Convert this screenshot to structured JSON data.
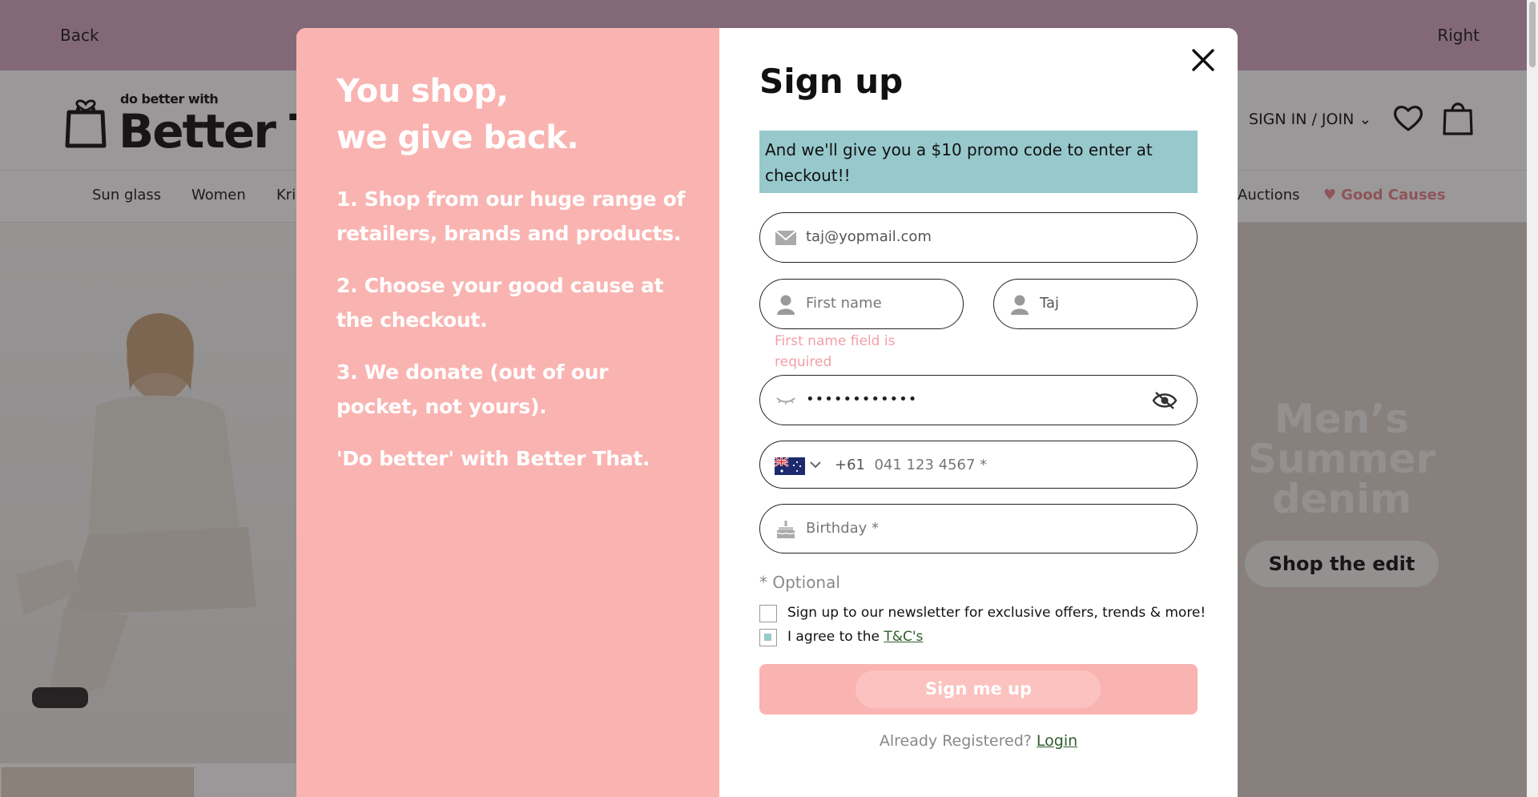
{
  "topbar": {
    "back_label": "Back",
    "right_label": "Right"
  },
  "header": {
    "logo_tagline": "do better with",
    "logo_text": "Better That",
    "signin_label": "SIGN IN / JOIN",
    "wishlist_icon": "heart-icon",
    "cart_icon": "shopping-bag-icon"
  },
  "nav": {
    "items": [
      "Sun glass",
      "Women",
      "Kri",
      "Auctions",
      "Good Causes"
    ]
  },
  "hero": {
    "title_line1": "Men’s",
    "title_line2": "Summer",
    "title_line3": "denim",
    "button_label": "Shop the edit"
  },
  "modal": {
    "left": {
      "title_line1": "You shop,",
      "title_line2": "we give back.",
      "step1": "1. Shop from our huge range of retailers, brands and products.",
      "step2": "2. Choose your good cause at the checkout.",
      "step3": "3. We donate (out of our pocket, not yours).",
      "tagline": "'Do better' with Better That."
    },
    "form": {
      "title": "Sign up",
      "promo": "And we'll give you a $10 promo code to enter at checkout!!",
      "email_value": "taj@yopmail.com",
      "first_name_placeholder": "First name",
      "last_name_value": "Taj",
      "first_name_error": "First name field is required",
      "password_value": "••••••••••••",
      "phone_country_code": "+61",
      "phone_placeholder": "041 123 4567 *",
      "birthday_placeholder": "Birthday *",
      "optional_note": "* Optional",
      "newsletter_label": "Sign up to our newsletter for exclusive offers, trends & more!",
      "newsletter_checked": false,
      "agree_label": "I agree to the",
      "agree_link": "T&C's",
      "agree_checked": true,
      "submit_label": "Sign me up",
      "already_label": "Already Registered?",
      "login_link": "Login"
    }
  },
  "colors": {
    "topbar": "#d5a9c4",
    "modal_left": "#f9b4b1",
    "promo_bg": "#97c8cc",
    "error": "#f2a0a6",
    "link": "#2f5d2c",
    "good_causes": "#e9868a"
  }
}
